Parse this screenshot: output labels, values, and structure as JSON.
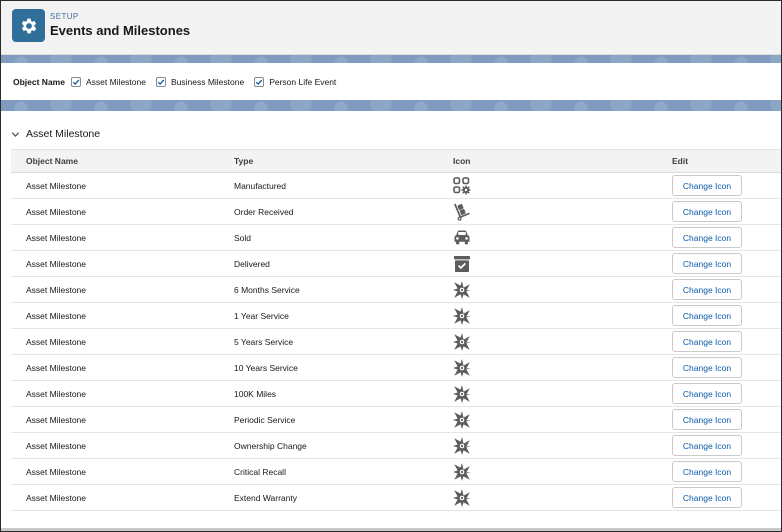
{
  "header": {
    "setup_label": "SETUP",
    "title": "Events and Milestones",
    "icon": "gear-icon"
  },
  "filter": {
    "label": "Object Name",
    "options": [
      {
        "label": "Asset Milestone",
        "checked": true
      },
      {
        "label": "Business Milestone",
        "checked": true
      },
      {
        "label": "Person Life Event",
        "checked": true
      }
    ]
  },
  "section": {
    "title": "Asset Milestone",
    "expanded": true
  },
  "table": {
    "columns": [
      "Object Name",
      "Type",
      "Icon",
      "Edit"
    ],
    "button_label": "Change Icon",
    "rows": [
      {
        "object": "Asset Milestone",
        "type": "Manufactured",
        "icon": "manufacturing-icon"
      },
      {
        "object": "Asset Milestone",
        "type": "Order Received",
        "icon": "dolly-icon"
      },
      {
        "object": "Asset Milestone",
        "type": "Sold",
        "icon": "car-icon"
      },
      {
        "object": "Asset Milestone",
        "type": "Delivered",
        "icon": "delivery-box-icon"
      },
      {
        "object": "Asset Milestone",
        "type": "6 Months Service",
        "icon": "service-star-icon"
      },
      {
        "object": "Asset Milestone",
        "type": "1 Year Service",
        "icon": "service-star-icon"
      },
      {
        "object": "Asset Milestone",
        "type": "5 Years Service",
        "icon": "service-star-icon"
      },
      {
        "object": "Asset Milestone",
        "type": "10 Years Service",
        "icon": "service-star-icon"
      },
      {
        "object": "Asset Milestone",
        "type": "100K Miles",
        "icon": "service-star-icon"
      },
      {
        "object": "Asset Milestone",
        "type": "Periodic Service",
        "icon": "service-star-icon"
      },
      {
        "object": "Asset Milestone",
        "type": "Ownership Change",
        "icon": "service-star-icon"
      },
      {
        "object": "Asset Milestone",
        "type": "Critical Recall",
        "icon": "service-star-icon"
      },
      {
        "object": "Asset Milestone",
        "type": "Extend Warranty",
        "icon": "service-star-icon"
      }
    ]
  },
  "colors": {
    "brand": "#2f6f9a",
    "link": "#0b5cab",
    "band": "#7f9cc0",
    "icon": "#5c5c5c"
  }
}
